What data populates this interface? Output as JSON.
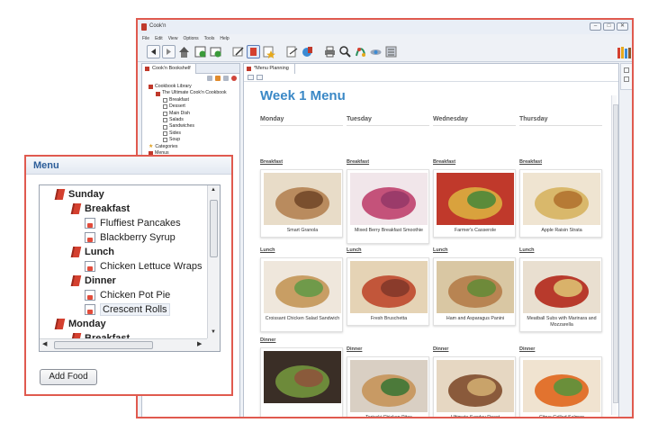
{
  "window": {
    "title": "Cook'n"
  },
  "menubar": [
    "File",
    "Edit",
    "View",
    "Options",
    "Tools",
    "Help"
  ],
  "toolbar_icons": [
    "back-icon",
    "forward-icon",
    "home-icon",
    "add-recipe-icon",
    "add-item-icon",
    "edit-icon",
    "bookshelf-icon",
    "favorite-star-icon",
    "import-icon",
    "export-icon",
    "print-icon",
    "search-icon",
    "mix-icon",
    "shop-icon",
    "calculator-icon",
    "library-books-icon"
  ],
  "bookshelf": {
    "tab_label": "Cook'n Bookshelf",
    "items": [
      {
        "label": "Cookbook Library",
        "level": 0,
        "icon": "library-icon"
      },
      {
        "label": "The Ultimate Cook'n Cookbook",
        "level": 1,
        "icon": "cookbook-icon"
      },
      {
        "label": "Breakfast",
        "level": 2,
        "icon": "section-icon"
      },
      {
        "label": "Dessert",
        "level": 2,
        "icon": "section-icon"
      },
      {
        "label": "Main Dish",
        "level": 2,
        "icon": "section-icon"
      },
      {
        "label": "Salads",
        "level": 2,
        "icon": "section-icon"
      },
      {
        "label": "Sandwiches",
        "level": 2,
        "icon": "section-icon"
      },
      {
        "label": "Sides",
        "level": 2,
        "icon": "section-icon"
      },
      {
        "label": "Soup",
        "level": 2,
        "icon": "section-icon"
      },
      {
        "label": "Categories",
        "level": 0,
        "icon": "star-icon"
      },
      {
        "label": "Menus",
        "level": 0,
        "icon": "menu-icon"
      }
    ]
  },
  "editor": {
    "tab_label": "*Menu Planning",
    "week_title": "Week 1 Menu",
    "days": [
      "Monday",
      "Tuesday",
      "Wednesday",
      "Thursday"
    ],
    "meals": [
      {
        "label": "Breakfast",
        "items": [
          "Smart Granola",
          "Mixed Berry Breakfast Smoothie",
          "Farmer's Casserole",
          "Apple Raisin Strata"
        ]
      },
      {
        "label": "Lunch",
        "items": [
          "Croissant Chicken Salad Sandwich",
          "Fresh Bruschetta",
          "Ham and Asparagus Panini",
          "Meatball Subs with Marinara and Mozzarella"
        ]
      },
      {
        "label": "Dinner",
        "items": [
          "",
          "Teriyaki Chicken Pitas",
          "Ultimate Sunday Roast",
          "Citrus Grilled Salmon"
        ]
      }
    ]
  },
  "callout": {
    "title": "Menu",
    "tree": [
      {
        "label": "Sunday",
        "level": 0,
        "icon": "menu-icon",
        "bold": true
      },
      {
        "label": "Breakfast",
        "level": 1,
        "icon": "menu-icon",
        "bold": true
      },
      {
        "label": "Fluffiest Pancakes",
        "level": 2,
        "icon": "recipe-icon",
        "bold": false
      },
      {
        "label": "Blackberry Syrup",
        "level": 2,
        "icon": "recipe-icon",
        "bold": false
      },
      {
        "label": "Lunch",
        "level": 1,
        "icon": "menu-icon",
        "bold": true
      },
      {
        "label": "Chicken Lettuce Wraps",
        "level": 2,
        "icon": "recipe-icon",
        "bold": false
      },
      {
        "label": "Dinner",
        "level": 1,
        "icon": "menu-icon",
        "bold": true
      },
      {
        "label": "Chicken Pot Pie",
        "level": 2,
        "icon": "recipe-icon",
        "bold": false
      },
      {
        "label": "Crescent Rolls",
        "level": 2,
        "icon": "recipe-icon",
        "bold": false,
        "selected": true
      },
      {
        "label": "Monday",
        "level": 0,
        "icon": "menu-icon",
        "bold": true
      },
      {
        "label": "Breakfast",
        "level": 1,
        "icon": "menu-icon",
        "bold": true
      }
    ],
    "add_button": "Add Food"
  },
  "colors": {
    "accent_red": "#e05a4f",
    "title_blue": "#3a88c6",
    "callout_blue": "#2c5d99"
  }
}
